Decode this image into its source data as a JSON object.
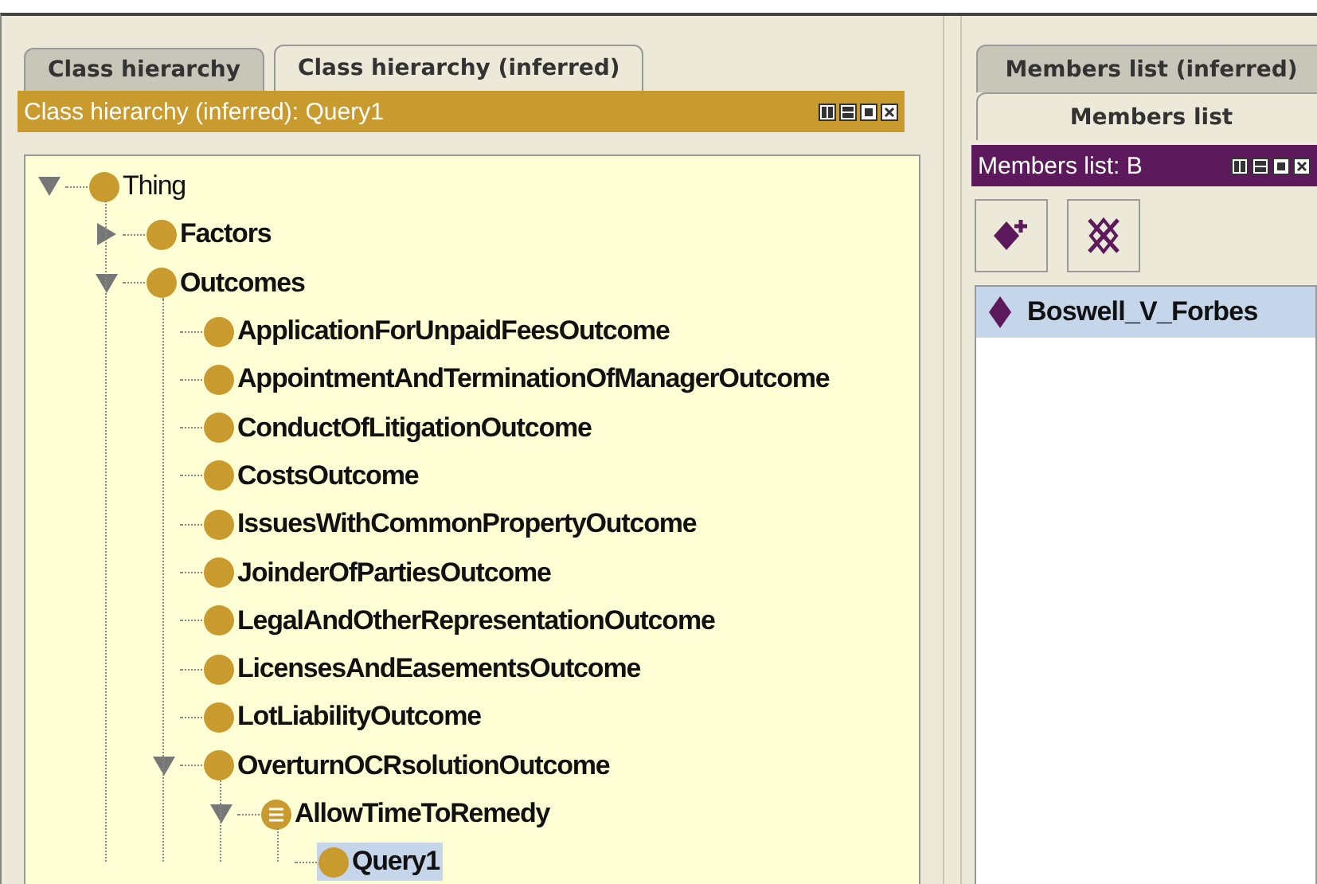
{
  "left_panel": {
    "tabs": [
      {
        "label": "Class hierarchy",
        "selected": false
      },
      {
        "label": "Class hierarchy (inferred)",
        "selected": true
      }
    ],
    "header": {
      "title": "Class hierarchy (inferred): Query1"
    },
    "tree": [
      {
        "label": "Thing",
        "kind": "class",
        "expanded": true,
        "selected": false,
        "children": [
          {
            "label": "Factors",
            "kind": "class",
            "expanded": false,
            "selected": false
          },
          {
            "label": "Outcomes",
            "kind": "class",
            "expanded": true,
            "selected": false,
            "children": [
              {
                "label": "ApplicationForUnpaidFeesOutcome",
                "kind": "class",
                "selected": false
              },
              {
                "label": "AppointmentAndTerminationOfManagerOutcome",
                "kind": "class",
                "selected": false
              },
              {
                "label": "ConductOfLitigationOutcome",
                "kind": "class",
                "selected": false
              },
              {
                "label": "CostsOutcome",
                "kind": "class",
                "selected": false
              },
              {
                "label": "IssuesWithCommonPropertyOutcome",
                "kind": "class",
                "selected": false
              },
              {
                "label": "JoinderOfPartiesOutcome",
                "kind": "class",
                "selected": false
              },
              {
                "label": "LegalAndOtherRepresentationOutcome",
                "kind": "class",
                "selected": false
              },
              {
                "label": "LicensesAndEasementsOutcome",
                "kind": "class",
                "selected": false
              },
              {
                "label": "LotLiabilityOutcome",
                "kind": "class",
                "selected": false
              },
              {
                "label": "OverturnOCRsolutionOutcome",
                "kind": "class",
                "expanded": true,
                "selected": false,
                "children": [
                  {
                    "label": "AllowTimeToRemedy",
                    "kind": "defined",
                    "expanded": true,
                    "selected": false,
                    "children": [
                      {
                        "label": "Query1",
                        "kind": "class",
                        "selected": true
                      }
                    ]
                  }
                ]
              }
            ]
          }
        ]
      }
    ]
  },
  "right_panel": {
    "tabs": [
      {
        "label": "Members list (inferred)",
        "selected": false
      },
      {
        "label": "Members list",
        "selected": true
      }
    ],
    "header": {
      "title": "Members list: B"
    },
    "toolbar": [
      {
        "kind": "add"
      },
      {
        "kind": "delete"
      }
    ],
    "members": [
      {
        "label": "Boswell_V_Forbes",
        "selected": true
      }
    ]
  }
}
